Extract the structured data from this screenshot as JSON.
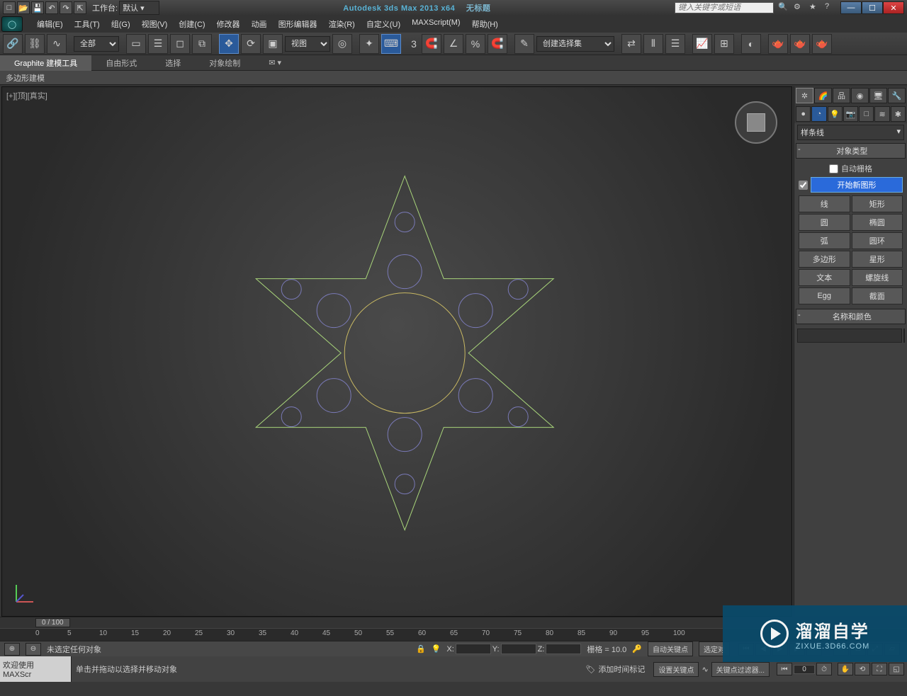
{
  "titlebar": {
    "workspace_label": "工作台:",
    "workspace_value": "默认",
    "app_title": "Autodesk 3ds Max  2013 x64",
    "doc_title": "无标题",
    "search_placeholder": "键入关键字或短语"
  },
  "menubar": {
    "items": [
      "编辑(E)",
      "工具(T)",
      "组(G)",
      "视图(V)",
      "创建(C)",
      "修改器",
      "动画",
      "图形编辑器",
      "渲染(R)",
      "自定义(U)",
      "MAXScript(M)",
      "帮助(H)"
    ]
  },
  "toolbar": {
    "filter_select": "全部",
    "view_select": "视图",
    "set_select": "创建选择集"
  },
  "ribbon": {
    "tabs": [
      "Graphite 建模工具",
      "自由形式",
      "选择",
      "对象绘制"
    ],
    "sub": "多边形建模"
  },
  "viewport": {
    "label": "[+][顶][真实]"
  },
  "cmdpanel": {
    "category": "样条线",
    "rollout_objtype": "对象类型",
    "autogrid": "自动栅格",
    "newshape": "开始新图形",
    "buttons": [
      [
        "线",
        "矩形"
      ],
      [
        "圆",
        "椭圆"
      ],
      [
        "弧",
        "圆环"
      ],
      [
        "多边形",
        "星形"
      ],
      [
        "文本",
        "螺旋线"
      ],
      [
        "Egg",
        "截面"
      ]
    ],
    "rollout_name": "名称和颜色",
    "name_value": ""
  },
  "timeline": {
    "slider": "0 / 100",
    "ticks": [
      "0",
      "5",
      "10",
      "15",
      "20",
      "25",
      "30",
      "35",
      "40",
      "45",
      "50",
      "55",
      "60",
      "65",
      "70",
      "75",
      "80",
      "85",
      "90",
      "95",
      "100"
    ]
  },
  "status": {
    "noselect": "未选定任何对象",
    "hint": "单击并拖动以选择并移动对象",
    "x": "X:",
    "y": "Y:",
    "z": "Z:",
    "grid_label": "栅格 = 10.0",
    "addmark": "添加时间标记",
    "autokey": "自动关键点",
    "setkey": "设置关键点",
    "selected": "选定对",
    "keyfilter": "关键点过滤器..."
  },
  "prompt": {
    "welcome": "欢迎使用",
    "script": "MAXScr"
  },
  "watermark": {
    "big": "溜溜自学",
    "small": "ZIXUE.3D66.COM"
  }
}
